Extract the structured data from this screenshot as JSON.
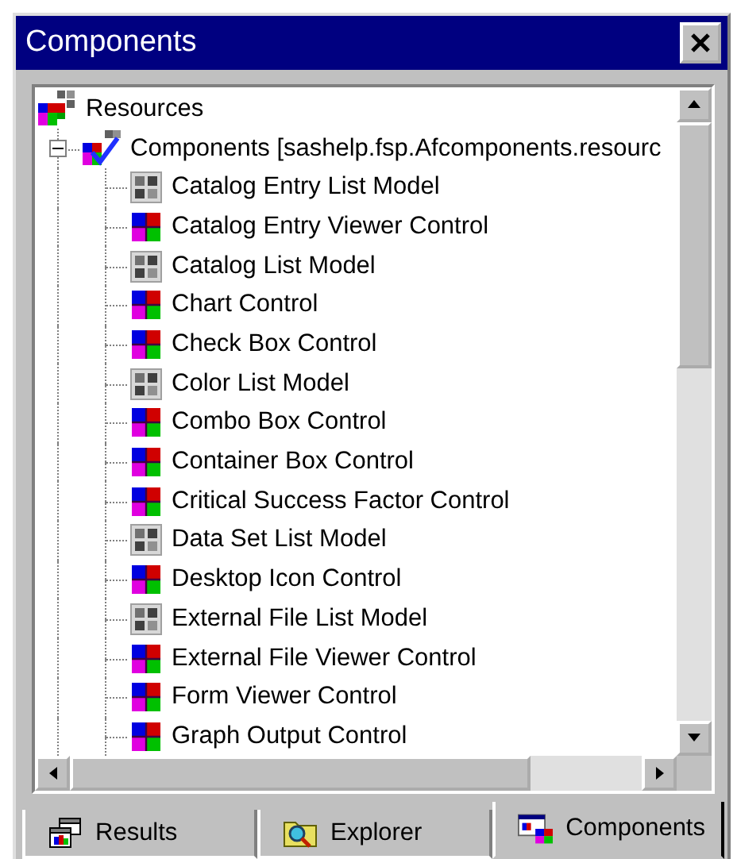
{
  "window": {
    "title": "Components"
  },
  "tree": [
    {
      "label": "Resources",
      "kind": "resources",
      "children": [
        {
          "label": "Components [sashelp.fsp.Afcomponents.resourc",
          "kind": "catalog",
          "expanded": true,
          "children": [
            {
              "label": "Catalog Entry List Model",
              "kind": "model"
            },
            {
              "label": "Catalog Entry Viewer Control",
              "kind": "control"
            },
            {
              "label": "Catalog List Model",
              "kind": "model"
            },
            {
              "label": "Chart Control",
              "kind": "control"
            },
            {
              "label": "Check Box Control",
              "kind": "control"
            },
            {
              "label": "Color List Model",
              "kind": "model"
            },
            {
              "label": "Combo Box Control",
              "kind": "control"
            },
            {
              "label": "Container Box Control",
              "kind": "control"
            },
            {
              "label": "Critical Success Factor Control",
              "kind": "control"
            },
            {
              "label": "Data Set List Model",
              "kind": "model"
            },
            {
              "label": "Desktop Icon Control",
              "kind": "control"
            },
            {
              "label": "External File List Model",
              "kind": "model"
            },
            {
              "label": "External File Viewer Control",
              "kind": "control"
            },
            {
              "label": "Form Viewer Control",
              "kind": "control"
            },
            {
              "label": "Graph Output Control",
              "kind": "control"
            }
          ]
        }
      ]
    }
  ],
  "tabs": [
    {
      "label": "Results",
      "kind": "results",
      "selected": false
    },
    {
      "label": "Explorer",
      "kind": "explorer",
      "selected": false
    },
    {
      "label": "Components",
      "kind": "components",
      "selected": true
    }
  ]
}
